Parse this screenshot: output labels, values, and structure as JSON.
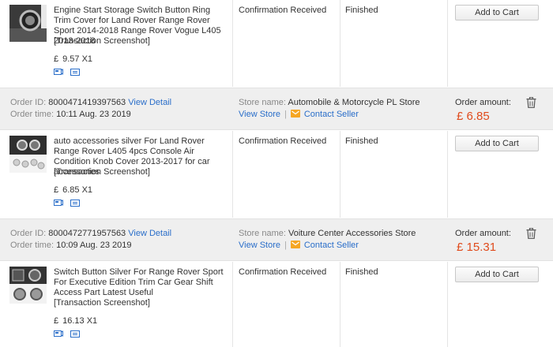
{
  "labels": {
    "order_id": "Order ID:",
    "order_time": "Order time:",
    "store_name": "Store name:",
    "view_detail": "View Detail",
    "view_store": "View Store",
    "contact_seller": "Contact Seller",
    "order_amount": "Order amount:",
    "add_to_cart": "Add to Cart",
    "transaction_screenshot": "[Transaction Screenshot]",
    "confirmation": "Confirmation Received",
    "finished": "Finished",
    "separator": "|",
    "currency": "£"
  },
  "orders": [
    {
      "title": "Engine Start Storage Switch Button Ring Trim Cover for Land Rover Range Rover Sport 2014-2018 Range Rover Vogue L405 2013-2018",
      "price": "9.57 X1"
    },
    {
      "order_id": "8000471419397563",
      "order_time": "10:11 Aug. 23 2019",
      "store_name": "Automobile & Motorcycle PL Store",
      "amount": "£ 6.85",
      "title": "auto accessories silver For Land Rover Range Rover L405 4pcs Console Air Condition Knob Cover 2013-2017 for car accessories",
      "price": "6.85 X1"
    },
    {
      "order_id": "8000472771957563",
      "order_time": "10:09 Aug. 23 2019",
      "store_name": "Voiture Center Accessories Store",
      "amount": "£ 15.31",
      "title": "Switch Button Silver For Range Rover Sport For Executive Edition Trim Car Gear Shift Access Part Latest Useful",
      "price": "16.13 X1"
    }
  ],
  "colors": {
    "link": "#2a6ec9",
    "amount": "#e04b1c",
    "header_bg": "#efefef",
    "chat_icon": "#f5a623"
  }
}
